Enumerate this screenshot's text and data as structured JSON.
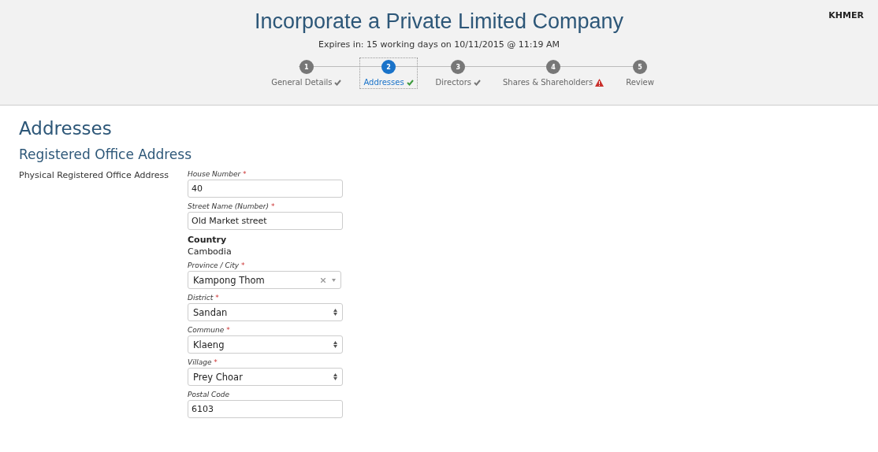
{
  "header": {
    "title": "Incorporate a Private Limited Company",
    "expiry": "Expires in: 15 working days on 10/11/2015 @ 11:19 AM",
    "language": "KHMER"
  },
  "steps": [
    {
      "number": "1",
      "label": "General Details",
      "complete": true,
      "warning": false,
      "selected": false
    },
    {
      "number": "2",
      "label": "Addresses",
      "complete": true,
      "warning": false,
      "selected": true
    },
    {
      "number": "3",
      "label": "Directors",
      "complete": true,
      "warning": false,
      "selected": false
    },
    {
      "number": "4",
      "label": "Shares & Shareholders",
      "complete": false,
      "warning": true,
      "selected": false
    },
    {
      "number": "5",
      "label": "Review",
      "complete": false,
      "warning": false,
      "selected": false
    }
  ],
  "page_title": "Addresses",
  "section_title": "Registered Office Address",
  "group_label": "Physical Registered Office Address",
  "fields": [
    {
      "kind": "text",
      "label": "House Number",
      "required_mark": "*",
      "value": "40"
    },
    {
      "kind": "text",
      "label": "Street Name (Number)",
      "required_mark": "*",
      "value": "Old Market street"
    },
    {
      "kind": "static",
      "label": "Country",
      "value": "Cambodia"
    },
    {
      "kind": "combo",
      "label": "Province / City",
      "required_mark": "*",
      "value": "Kampong Thom"
    },
    {
      "kind": "select",
      "label": "District",
      "required_mark": "*",
      "value": "Sandan"
    },
    {
      "kind": "select",
      "label": "Commune",
      "required_mark": "*",
      "value": "Klaeng"
    },
    {
      "kind": "select",
      "label": "Village",
      "required_mark": "*",
      "value": "Prey Choar"
    },
    {
      "kind": "text",
      "label": "Postal Code",
      "value": "6103"
    }
  ]
}
